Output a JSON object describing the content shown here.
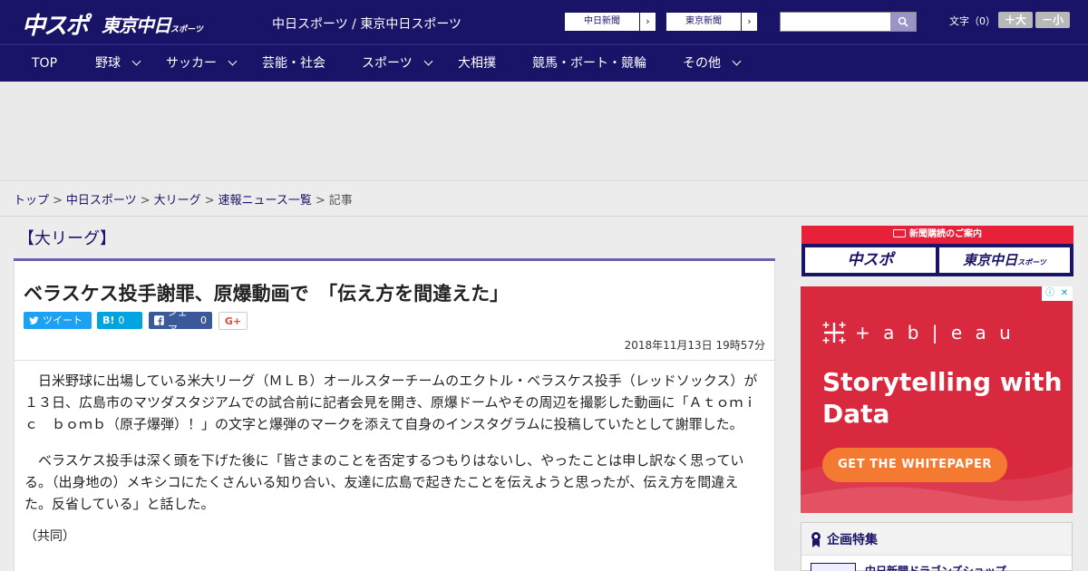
{
  "header": {
    "logo_main": "中スポ",
    "logo_tokyo": "東京中日",
    "logo_tokyo_small": "スポーツ",
    "site_title": "中日スポーツ / 東京中日スポーツ",
    "link_chunichi": "中日新聞",
    "link_tokyo": "東京新聞",
    "link_arrow": "›",
    "search": {
      "placeholder": "",
      "icon": "search-icon"
    },
    "font_size_label": "文字（0）",
    "font_larger": "＋大",
    "font_smaller": "－小"
  },
  "nav": {
    "items": [
      {
        "label": "TOP",
        "has_dropdown": false
      },
      {
        "label": "野球",
        "has_dropdown": true
      },
      {
        "label": "サッカー",
        "has_dropdown": true
      },
      {
        "label": "芸能・社会",
        "has_dropdown": false
      },
      {
        "label": "スポーツ",
        "has_dropdown": true
      },
      {
        "label": "大相撲",
        "has_dropdown": false
      },
      {
        "label": "競馬・ボート・競輪",
        "has_dropdown": false
      },
      {
        "label": "その他",
        "has_dropdown": true
      }
    ]
  },
  "breadcrumb": {
    "items": [
      "トップ",
      "中日スポーツ",
      "大リーグ",
      "速報ニュース一覧"
    ],
    "current": "記事",
    "separator": ">"
  },
  "article": {
    "category": "【大リーグ】",
    "headline": "ベラスケス投手謝罪、原爆動画で　「伝え方を間違えた」",
    "share": {
      "tweet_label": "ツイート",
      "hatena_label": "B!",
      "hatena_count": "0",
      "facebook_label": "シェア",
      "facebook_count": "0",
      "gplus_label": "G+"
    },
    "timestamp": "2018年11月13日 19時57分",
    "paragraphs": [
      "日米野球に出場している米大リーグ（ＭＬＢ）オールスターチームのエクトル・ベラスケス投手（レッドソックス）が１３日、広島市のマツダスタジアムでの試合前に記者会見を開き、原爆ドームやその周辺を撮影した動画に「Ａｔｏｍｉｃ　ｂｏｍｂ（原子爆弾）！」の文字と爆弾のマークを添えて自身のインスタグラムに投稿していたとして謝罪した。",
      "ベラスケス投手は深く頭を下げた後に「皆さまのことを否定するつもりはないし、やったことは申し訳なく思っている。（出身地の）メキシコにたくさんいる知り合い、友達に広島で起きたことを伝えようと思ったが、伝え方を間違えた。反省している」と話した。"
    ],
    "credit": "（共同）"
  },
  "sidebar": {
    "subscribe_title": "新聞購読のご案内",
    "subscribe_chuspo": "中スポ",
    "subscribe_tokyo": "東京中日",
    "subscribe_tokyo_small": "スポーツ",
    "ad": {
      "brand": "+ a b | e a u",
      "headline": "Storytelling with Data",
      "cta": "GET THE WHITEPAPER",
      "info_icon": "ⓘ",
      "close_icon": "✕"
    },
    "feature": {
      "title": "企画特集",
      "item": "中日新聞ドラゴンズショップ"
    }
  },
  "colors": {
    "brand_navy": "#1a1468",
    "accent_red": "#e8203a",
    "ad_red": "#d8293f",
    "ad_orange": "#f47a32",
    "twitter": "#1da1f2",
    "hatena": "#00a4de",
    "facebook": "#3b5998"
  }
}
